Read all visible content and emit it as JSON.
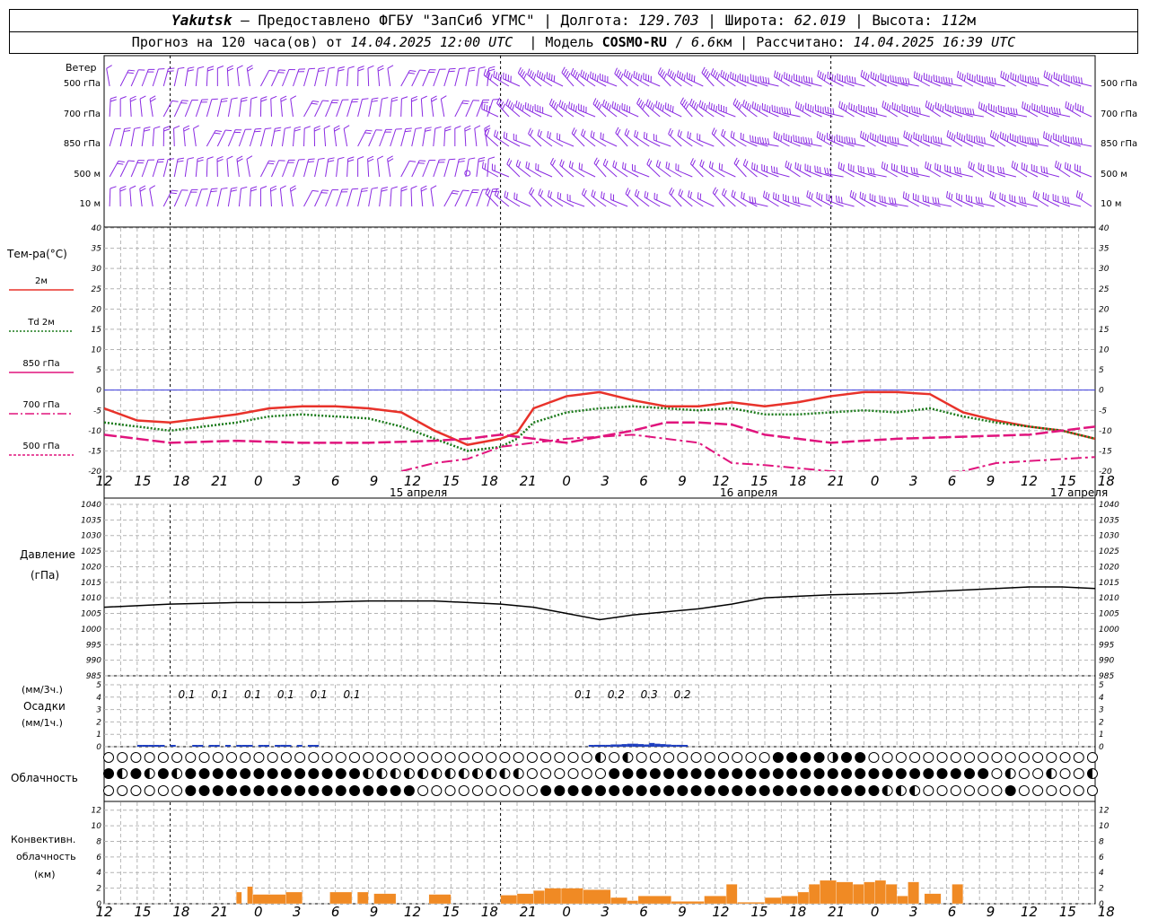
{
  "header": {
    "station": "Yakutsk",
    "dash": "—",
    "provider": "Предоставлено ФГБУ \"ЗапСиб УГМС\"",
    "lon_label": "Долгота:",
    "lon": "129.703",
    "lat_label": "Широта:",
    "lat": "62.019",
    "alt_label": "Высота:",
    "alt": "112",
    "alt_unit": "м",
    "sep": "|",
    "fc_prefix": "Прогноз на 120 часа(ов) от",
    "fc_start": "14.04.2025 12:00 UTC",
    "model_label": "Модель",
    "model": "COSMO-RU",
    "model_sep": "/",
    "res": "6.6",
    "res_unit": "км",
    "calc_label": "Рассчитано:",
    "calc": "14.04.2025 16:39 UTC"
  },
  "wind": {
    "title": "Ветер",
    "levels": [
      "500 гПа",
      "700 гПа",
      "850 гПа",
      "500 м",
      "10  м"
    ]
  },
  "temperature": {
    "title": "Тем-ра(°C)",
    "legend": [
      "2м",
      "Td  2м",
      "850 гПа",
      "700 гПа",
      "500 гПа"
    ]
  },
  "pressure": {
    "title": "Давление",
    "unit": "(гПа)"
  },
  "precip": {
    "unit_top": "(мм/3ч.)",
    "title": "Осадки",
    "unit_bottom": "(мм/1ч.)"
  },
  "clouds": {
    "title": "Облачность"
  },
  "convective": {
    "title_1": "Конвективн.",
    "title_2": "облачность",
    "unit": "(км)"
  },
  "colors": {
    "wind": "#8a2be2",
    "t2m": "#e8322a",
    "td2m": "#1a7a1a",
    "magenta": "#e0147d",
    "pressure": "#000000",
    "precip": "#1f3fbf",
    "conv": "#f08a24",
    "zero_line": "#3b3bdd",
    "grid": "#b4b4b4"
  },
  "chart_data": [
    {
      "type": "line",
      "name": "temperature",
      "x_hours": [
        0,
        6,
        12,
        18,
        24,
        30,
        36,
        42,
        48,
        54,
        60,
        66,
        72,
        75,
        78,
        84,
        90,
        96,
        102,
        108,
        114,
        120,
        126,
        132,
        138,
        144,
        150,
        156,
        162,
        168,
        174,
        180
      ],
      "x_tick_labels": [
        "12",
        "15",
        "18",
        "21",
        "0",
        "3",
        "6",
        "9",
        "12",
        "15",
        "18",
        "21",
        "0",
        "3",
        "6",
        "9",
        "12",
        "15",
        "18",
        "21",
        "0",
        "3",
        "6",
        "9",
        "12",
        "15",
        "18"
      ],
      "date_labels": [
        "15 апреля",
        "16 апреля",
        "17 апреля"
      ],
      "ylim": [
        -20,
        40
      ],
      "y_ticks": [
        40,
        35,
        30,
        25,
        20,
        15,
        10,
        5,
        0,
        -5,
        -10,
        -15,
        -20
      ],
      "series": [
        {
          "name": "2м",
          "style": "solid",
          "color": "#e8322a",
          "x": [
            0,
            6,
            12,
            18,
            24,
            30,
            36,
            42,
            48,
            54,
            60,
            66,
            72,
            75,
            78,
            84,
            90,
            96,
            102,
            108,
            114,
            120,
            126,
            132,
            138,
            144,
            150,
            156,
            162,
            168,
            174,
            180
          ],
          "values": [
            -4.5,
            -7.5,
            -8,
            -7,
            -6,
            -4.5,
            -4,
            -4,
            -4.5,
            -5.5,
            -10,
            -13.5,
            -12,
            -10.5,
            -4.5,
            -1.5,
            -0.5,
            -2.5,
            -4,
            -4,
            -3,
            -4,
            -3,
            -1.5,
            -0.5,
            -0.5,
            -1,
            -5.5,
            -7.5,
            -9,
            -10,
            -12
          ]
        },
        {
          "name": "Td  2м",
          "style": "dotted",
          "color": "#1a7a1a",
          "x": [
            0,
            6,
            12,
            18,
            24,
            30,
            36,
            42,
            48,
            54,
            60,
            66,
            72,
            75,
            78,
            84,
            90,
            96,
            102,
            108,
            114,
            120,
            126,
            132,
            138,
            144,
            150,
            156,
            162,
            168,
            174,
            180
          ],
          "values": [
            -8,
            -9,
            -10,
            -9,
            -8,
            -6.5,
            -6,
            -6.5,
            -7,
            -9,
            -12,
            -15,
            -14,
            -12,
            -8,
            -5.5,
            -4.5,
            -4,
            -4.5,
            -5,
            -4.5,
            -6,
            -6,
            -5.5,
            -5,
            -5.5,
            -4.5,
            -6.5,
            -8,
            -9,
            -10,
            -12
          ]
        },
        {
          "name": "850 гПа",
          "style": "longdash",
          "color": "#e0147d",
          "x": [
            0,
            12,
            24,
            36,
            48,
            60,
            66,
            72,
            84,
            96,
            102,
            108,
            114,
            120,
            132,
            144,
            156,
            168,
            174,
            180
          ],
          "values": [
            -11,
            -13,
            -12.5,
            -13,
            -13,
            -12.5,
            -12,
            -11,
            -13,
            -10,
            -8,
            -8,
            -8.5,
            -11,
            -13,
            -12,
            -11.5,
            -11,
            -10,
            -9
          ]
        },
        {
          "name": "700 гПа",
          "style": "dashdot",
          "color": "#e0147d",
          "x": [
            54,
            60,
            66,
            72,
            78,
            84,
            96,
            102,
            108,
            114,
            120,
            132,
            144,
            156,
            162,
            168,
            174,
            180
          ],
          "values": [
            -20,
            -18,
            -17,
            -14,
            -13,
            -12,
            -11,
            -12,
            -13,
            -18,
            -18.5,
            -20,
            -21,
            -20,
            -18,
            -17.5,
            -17,
            -16.5
          ]
        }
      ]
    },
    {
      "type": "line",
      "name": "pressure",
      "x_hours": [
        0,
        12,
        24,
        36,
        48,
        60,
        66,
        72,
        78,
        84,
        90,
        96,
        102,
        108,
        114,
        120,
        132,
        144,
        156,
        168,
        174,
        180
      ],
      "ylim": [
        985,
        1040
      ],
      "y_ticks": [
        1040,
        1035,
        1030,
        1025,
        1020,
        1015,
        1010,
        1005,
        1000,
        995,
        990,
        985
      ],
      "series": [
        {
          "name": "",
          "values": [
            1007,
            1008,
            1008.5,
            1008.5,
            1009,
            1009,
            1008.5,
            1008,
            1007,
            1005,
            1003,
            1004.5,
            1005.5,
            1006.5,
            1008,
            1010,
            1011,
            1011.5,
            1012.5,
            1013.5,
            1013.5,
            1013
          ]
        }
      ]
    },
    {
      "type": "bar",
      "name": "precipitation",
      "ylim": [
        0,
        5
      ],
      "y_ticks": [
        5,
        4,
        3,
        2,
        1,
        0
      ],
      "labels_3h": [
        {
          "hour": 15,
          "value": "0.1"
        },
        {
          "hour": 21,
          "value": "0.1"
        },
        {
          "hour": 27,
          "value": "0.1"
        },
        {
          "hour": 33,
          "value": "0.1"
        },
        {
          "hour": 39,
          "value": "0.1"
        },
        {
          "hour": 45,
          "value": "0.1"
        },
        {
          "hour": 87,
          "value": "0.1"
        },
        {
          "hour": 93,
          "value": "0.2"
        },
        {
          "hour": 99,
          "value": "0.3"
        },
        {
          "hour": 105,
          "value": "0.2"
        }
      ],
      "hourly": [
        [
          6,
          0.02
        ],
        [
          7,
          0.02
        ],
        [
          8,
          0.03
        ],
        [
          9,
          0.02
        ],
        [
          10,
          0.02
        ],
        [
          12,
          0.03
        ],
        [
          16,
          0.03
        ],
        [
          17,
          0.02
        ],
        [
          19,
          0.02
        ],
        [
          20,
          0.02
        ],
        [
          22,
          0.02
        ],
        [
          24,
          0.02
        ],
        [
          25,
          0.02
        ],
        [
          26,
          0.03
        ],
        [
          28,
          0.03
        ],
        [
          29,
          0.02
        ],
        [
          31,
          0.03
        ],
        [
          32,
          0.05
        ],
        [
          33,
          0.03
        ],
        [
          35,
          0.02
        ],
        [
          37,
          0.02
        ],
        [
          38,
          0.02
        ],
        [
          88,
          0.03
        ],
        [
          89,
          0.05
        ],
        [
          90,
          0.05
        ],
        [
          91,
          0.05
        ],
        [
          92,
          0.06
        ],
        [
          93,
          0.06
        ],
        [
          94,
          0.07
        ],
        [
          95,
          0.08
        ],
        [
          96,
          0.08
        ],
        [
          97,
          0.07
        ],
        [
          98,
          0.06
        ],
        [
          99,
          0.1
        ],
        [
          100,
          0.08
        ],
        [
          101,
          0.07
        ],
        [
          102,
          0.06
        ],
        [
          103,
          0.05
        ],
        [
          104,
          0.05
        ],
        [
          105,
          0.04
        ]
      ]
    },
    {
      "type": "bar",
      "name": "convective_cloud",
      "ylim": [
        0,
        13
      ],
      "y_ticks": [
        12,
        10,
        8,
        6,
        4,
        2,
        0
      ],
      "bars": [
        [
          18,
          3,
          1
        ],
        [
          24,
          25,
          1.5
        ],
        [
          26,
          27,
          2.2
        ],
        [
          27,
          33,
          1.2
        ],
        [
          33,
          36,
          1.5
        ],
        [
          41,
          45,
          1.5
        ],
        [
          46,
          48,
          1.5
        ],
        [
          49,
          53,
          1.3
        ],
        [
          59,
          63,
          1.2
        ],
        [
          72,
          75,
          1.1
        ],
        [
          75,
          78,
          1.3
        ],
        [
          78,
          80,
          1.7
        ],
        [
          80,
          83,
          2
        ],
        [
          83,
          87,
          2
        ],
        [
          87,
          92,
          1.8
        ],
        [
          92,
          95,
          0.8
        ],
        [
          95,
          97,
          0.4
        ],
        [
          97,
          103,
          1
        ],
        [
          103,
          109,
          0.3
        ],
        [
          109,
          113,
          1
        ],
        [
          113,
          115,
          2.5
        ],
        [
          115,
          120,
          0.2
        ],
        [
          120,
          123,
          0.8
        ],
        [
          123,
          126,
          1
        ],
        [
          126,
          128,
          1.5
        ],
        [
          128,
          130,
          2.5
        ],
        [
          130,
          133,
          3
        ],
        [
          133,
          136,
          2.8
        ],
        [
          136,
          138,
          2.5
        ],
        [
          138,
          140,
          2.8
        ],
        [
          140,
          142,
          3
        ],
        [
          142,
          144,
          2.5
        ],
        [
          144,
          146,
          1
        ],
        [
          146,
          148,
          2.8
        ],
        [
          149,
          152,
          1.3
        ],
        [
          154,
          156,
          2.5
        ]
      ]
    }
  ]
}
